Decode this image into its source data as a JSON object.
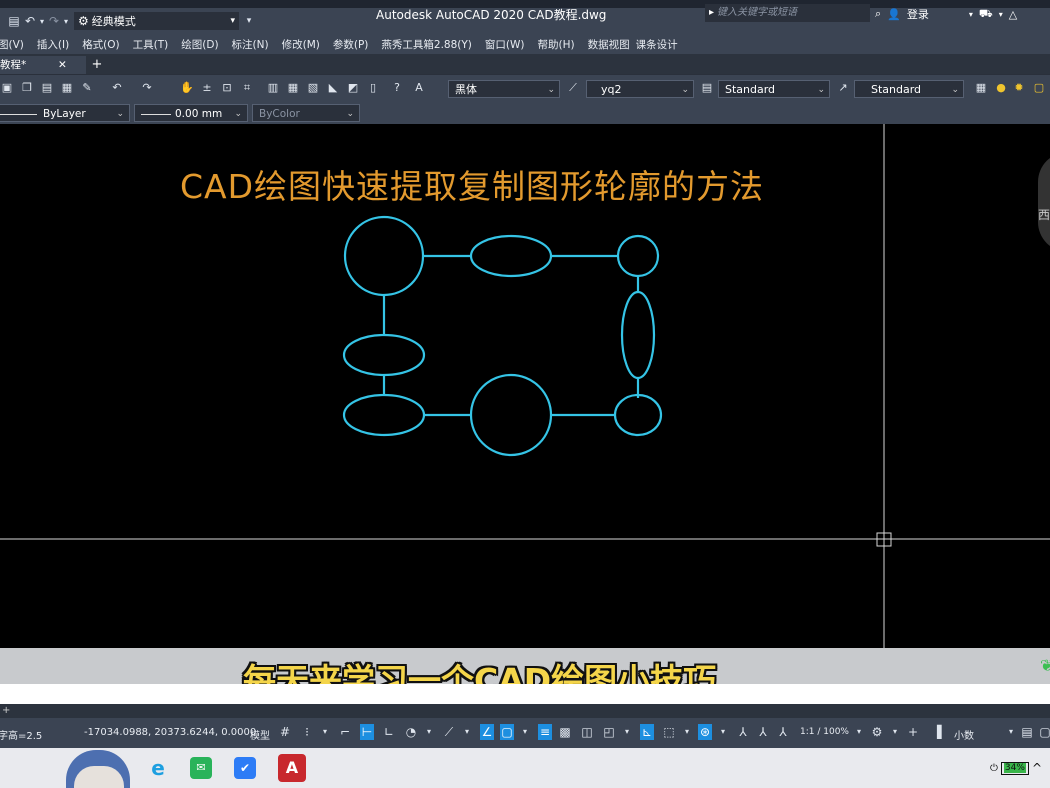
{
  "titlebar": {
    "workspace": "经典模式",
    "app_title": "Autodesk AutoCAD 2020   CAD教程.dwg",
    "search_placeholder": "键入关键字或短语",
    "login_label": "登录"
  },
  "menubar": {
    "items": [
      "图(V)",
      "插入(I)",
      "格式(O)",
      "工具(T)",
      "绘图(D)",
      "标注(N)",
      "修改(M)",
      "参数(P)",
      "燕秀工具箱2.88(Y)",
      "窗口(W)",
      "帮助(H)",
      "数据视图",
      "课条设计"
    ]
  },
  "tabbar": {
    "doc_tab": "教程*",
    "close_glyph": "✕",
    "new_tab_glyph": "+"
  },
  "toolbar1": {
    "font_combo": "黑体",
    "dim_style_combo": "yq2",
    "table_style_combo": "Standard",
    "multileader_style_combo": "Standard"
  },
  "toolbar2": {
    "linetype_combo": "ByLayer",
    "lineweight_combo": "0.00 mm",
    "color_combo": "ByColor"
  },
  "canvas": {
    "drawing_title": "CAD绘图快速提取复制图形轮廓的方法",
    "shape_color": "#35c4e6",
    "title_color": "#e39a2e",
    "viewcube_label": "西"
  },
  "subtitle": {
    "text": "每天来学习一个CAD绘图小技巧",
    "color": "#f4d54a"
  },
  "layout_strip": {
    "add_glyph": "+"
  },
  "statusbar": {
    "text_height": "字高=2.5",
    "coordinates": "-17034.0988, 20373.6244, 0.0000",
    "model_label": "模型",
    "scale": "1:1 / 100%",
    "units": "小数"
  },
  "taskbar": {
    "battery_level": "34%"
  }
}
